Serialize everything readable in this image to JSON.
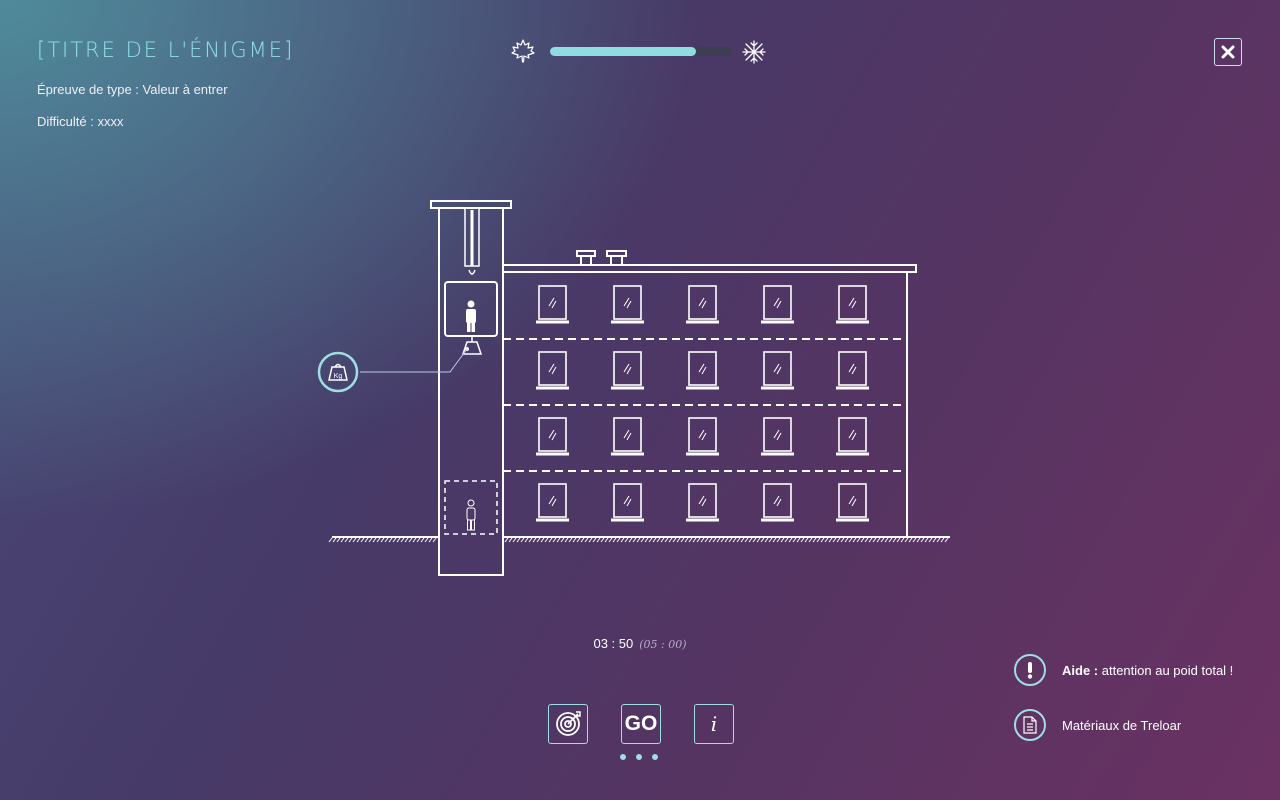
{
  "header": {
    "title": "[TITRE DE L'ÉNIGME]",
    "type_line": "Épreuve de type : Valeur à entrer",
    "difficulty_line": "Difficulté : xxxx"
  },
  "progress": {
    "value": 0.8,
    "start_icon": "maple-leaf-icon",
    "end_icon": "snowflake-icon",
    "fill_color": "#8fdde0"
  },
  "close_icon": "close-icon",
  "scene": {
    "weight_icon": "kg-weight-icon",
    "weight_label": "Kg",
    "floors": 4,
    "windows_per_floor": 5
  },
  "timer": {
    "elapsed": "03 : 50",
    "total": "(05 : 00)"
  },
  "controls": {
    "target_icon": "target-icon",
    "go_label": "GO",
    "info_label": "i",
    "page_dots": 3
  },
  "side": {
    "hint_icon": "exclamation-icon",
    "hint_bold": "Aide :",
    "hint_text": " attention au poid total !",
    "materials_icon": "document-icon",
    "materials_text": "Matériaux de Treloar"
  },
  "colors": {
    "accent": "#9fdfe3",
    "title": "#8fe0e6"
  }
}
